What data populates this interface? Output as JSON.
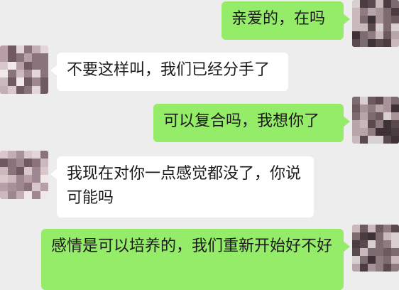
{
  "colors": {
    "background": "#ededed",
    "incoming_bubble": "#ffffff",
    "outgoing_bubble": "#95ec69",
    "text": "#1a1a1a"
  },
  "messages": [
    {
      "sender": "me",
      "text": "亲爱的，在吗"
    },
    {
      "sender": "other",
      "text": "不要这样叫，我们已经分手了"
    },
    {
      "sender": "me",
      "text": "可以复合吗，我想你了"
    },
    {
      "sender": "other",
      "text": "我现在对你一点感觉都没了，你说可能吗"
    },
    {
      "sender": "me",
      "text": "感情是可以培养的，我们重新开始好不好"
    }
  ]
}
